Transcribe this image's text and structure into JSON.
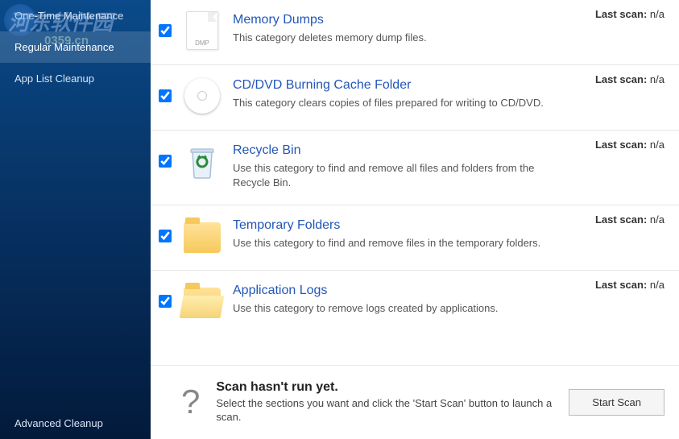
{
  "watermark": {
    "main": "河东软件园",
    "sub": "0359.cn"
  },
  "sidebar": {
    "items": [
      {
        "label": "One-Time Maintenance",
        "selected": false
      },
      {
        "label": "Regular Maintenance",
        "selected": true
      },
      {
        "label": "App List Cleanup",
        "selected": false
      }
    ],
    "bottom": {
      "label": "Advanced Cleanup"
    }
  },
  "categories": [
    {
      "checked": true,
      "icon": "dmp",
      "title": "Memory Dumps",
      "desc": "This category deletes memory dump files.",
      "last_scan_label": "Last scan:",
      "last_scan_value": "n/a"
    },
    {
      "checked": true,
      "icon": "cd",
      "title": "CD/DVD Burning Cache Folder",
      "desc": "This category clears copies of files prepared for writing to CD/DVD.",
      "last_scan_label": "Last scan:",
      "last_scan_value": "n/a"
    },
    {
      "checked": true,
      "icon": "bin",
      "title": "Recycle Bin",
      "desc": "Use this category to find and remove all files and folders from the Recycle Bin.",
      "last_scan_label": "Last scan:",
      "last_scan_value": "n/a"
    },
    {
      "checked": true,
      "icon": "folder",
      "title": "Temporary Folders",
      "desc": "Use this category to find and remove files in the temporary folders.",
      "last_scan_label": "Last scan:",
      "last_scan_value": "n/a"
    },
    {
      "checked": true,
      "icon": "folder-open",
      "title": "Application Logs",
      "desc": "Use this category to remove logs created by applications.",
      "last_scan_label": "Last scan:",
      "last_scan_value": "n/a"
    }
  ],
  "footer": {
    "title": "Scan hasn't run yet.",
    "desc": "Select the sections you want and click the 'Start Scan' button to launch a scan.",
    "button": "Start Scan"
  }
}
